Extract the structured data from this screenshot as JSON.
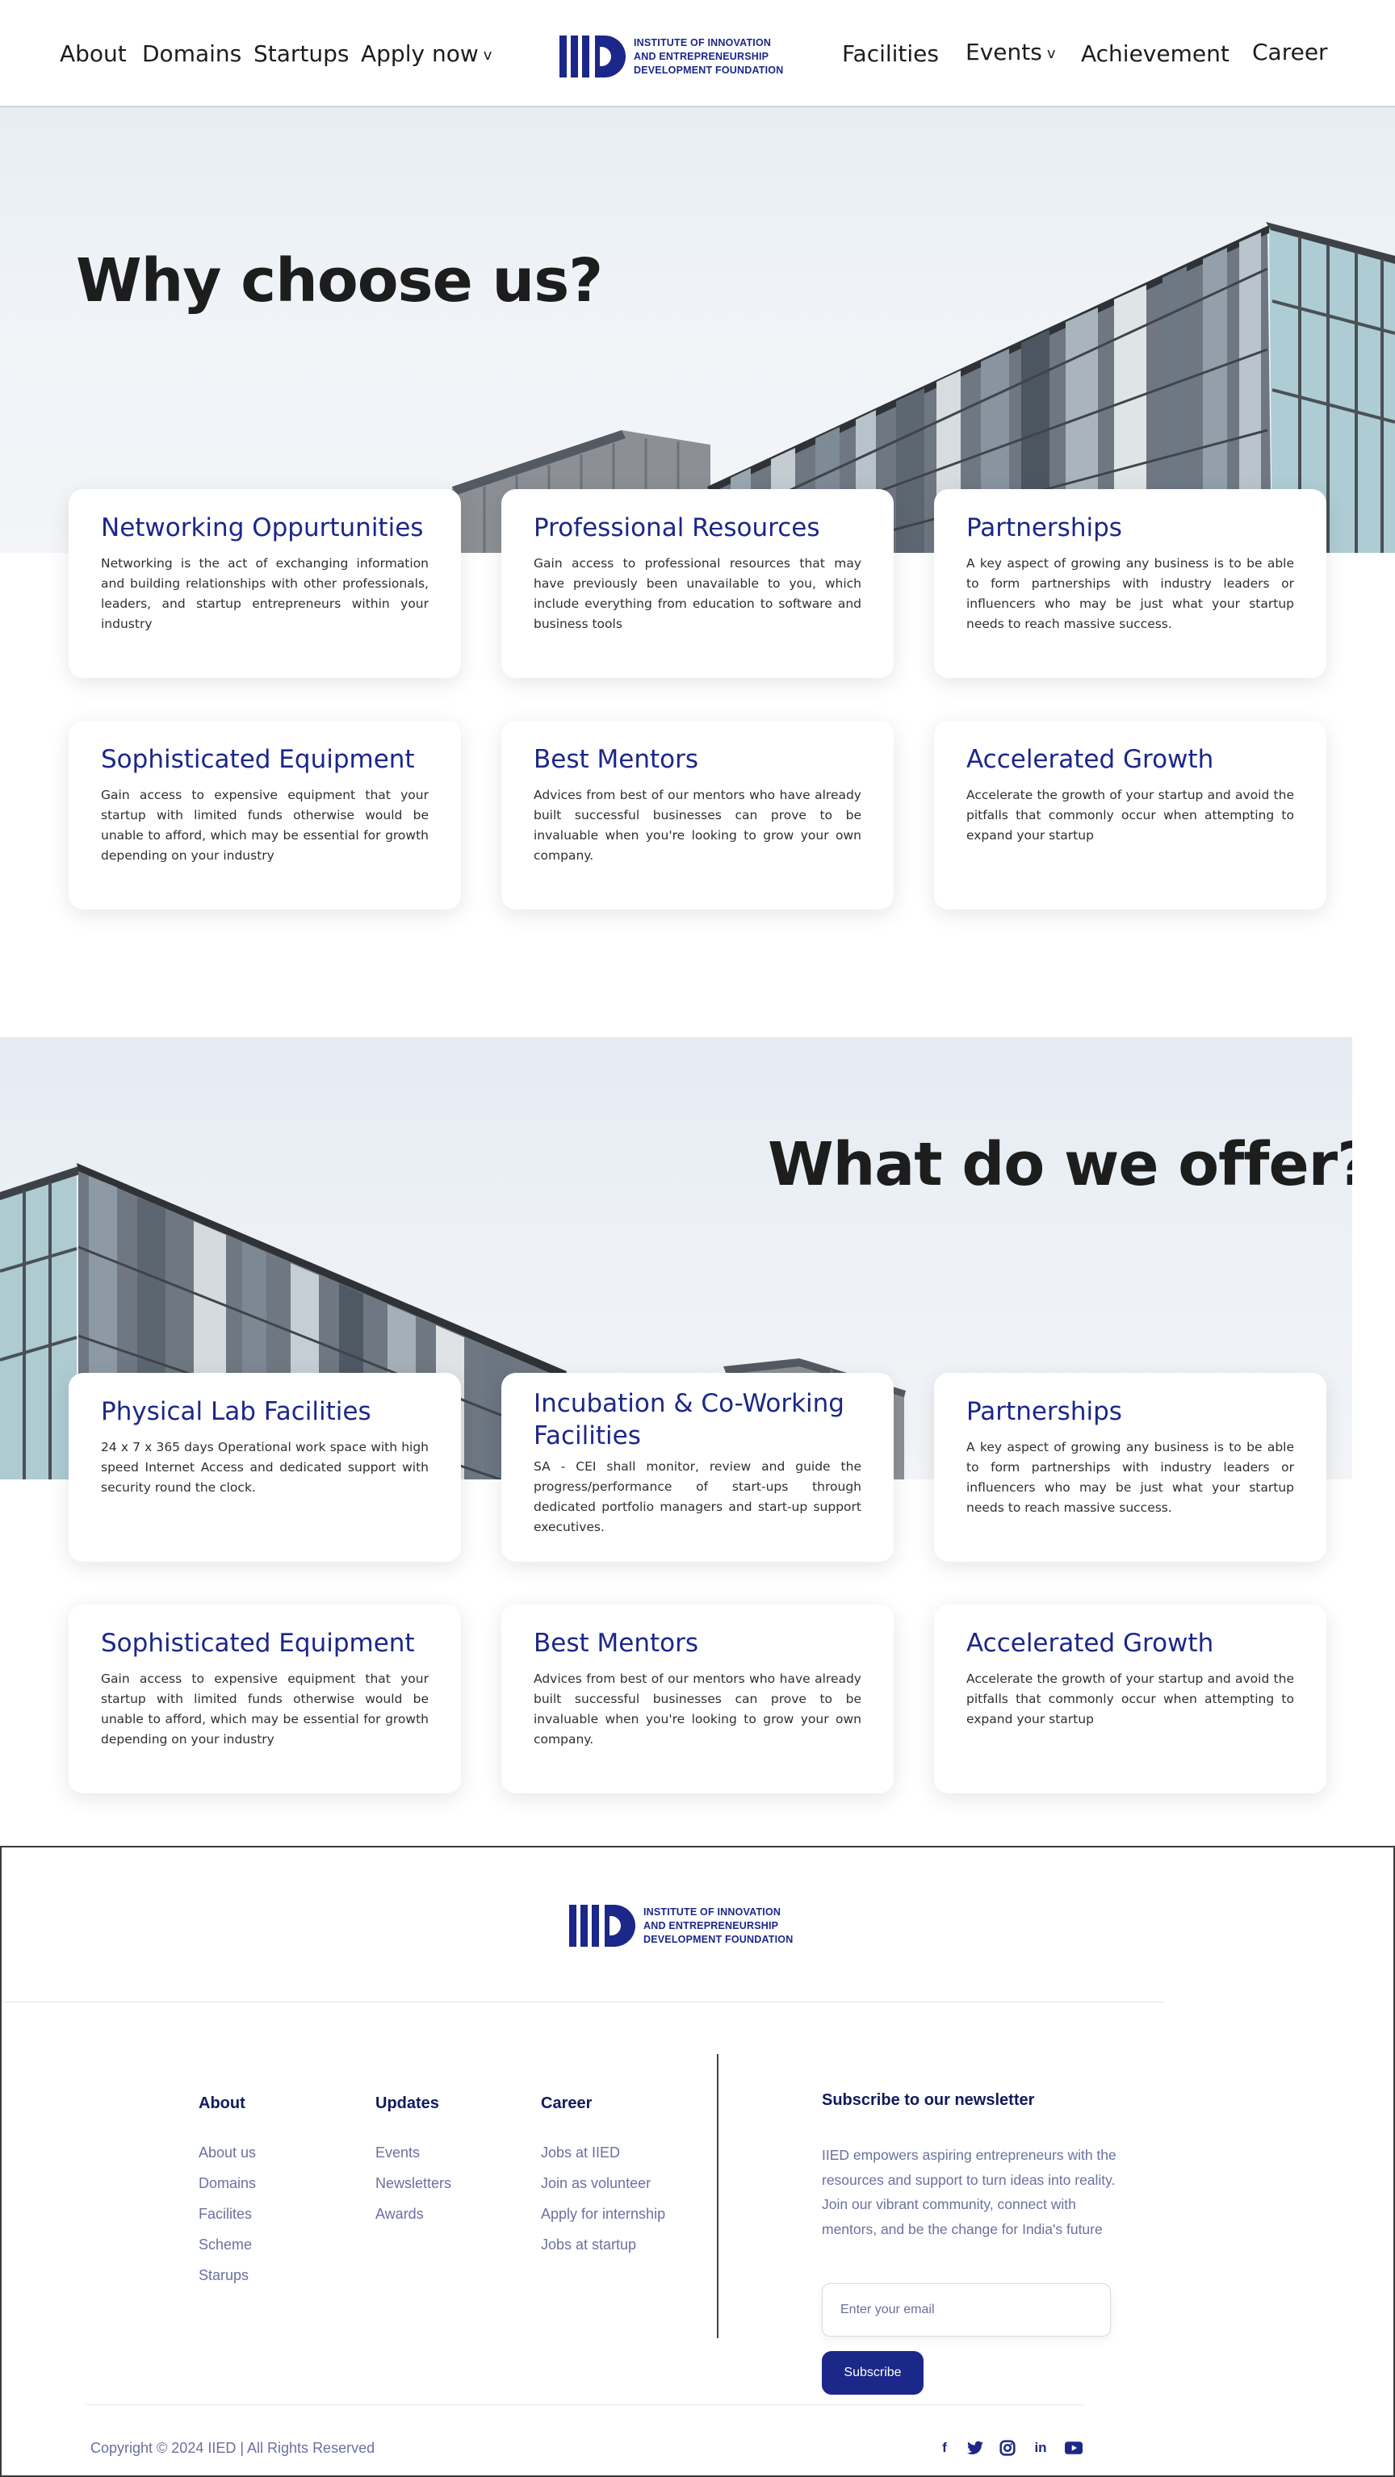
{
  "header": {
    "nav_left": [
      "About",
      "Domains",
      "Startups",
      "Apply now"
    ],
    "nav_right": [
      "Facilities",
      "Events",
      "Achievement",
      "Career"
    ],
    "caret": "v",
    "logo_lines": [
      "INSTITUTE OF INNOVATION",
      "AND ENTREPRENEURSHIP",
      "DEVELOPMENT FOUNDATION"
    ]
  },
  "section1": {
    "title": "Why choose us?",
    "cards": [
      {
        "title": "Networking Oppurtunities",
        "text": "Networking is the act of exchanging information and building relationships with other professionals, leaders, and startup entrepreneurs within your industry"
      },
      {
        "title": "Professional Resources",
        "text": "Gain access to professional resources that may have previously been unavailable to you, which include everything from education to software and business tools"
      },
      {
        "title": "Partnerships",
        "text": "A key aspect of growing any business is to be able to form partnerships with industry leaders or influencers who may be just what your startup needs to reach massive success."
      },
      {
        "title": "Sophisticated Equipment",
        "text": "Gain access to expensive equipment that your startup with limited funds otherwise would be unable to afford, which may be essential for growth depending on your industry"
      },
      {
        "title": "Best Mentors",
        "text": "Advices from best of our mentors who have already built successful businesses can prove to be invaluable when you're looking to grow your own company."
      },
      {
        "title": "Accelerated Growth",
        "text": "Accelerate the growth of your startup and avoid the pitfalls that commonly occur when attempting to expand your startup"
      }
    ]
  },
  "section2": {
    "title": "What do we offer?",
    "cards": [
      {
        "title": "Physical Lab Facilities",
        "text": "24 x 7 x 365 days Operational work space with high speed Internet Access and dedicated support with security round the clock."
      },
      {
        "title": "Incubation & Co-Working Facilities",
        "text": "SA - CEI shall monitor, review and guide the progress/performance of start-ups through dedicated portfolio managers and start-up support executives."
      },
      {
        "title": "Partnerships",
        "text": "A key aspect of growing any business is to be able to form partnerships with industry leaders or influencers who may be just what your startup needs to reach massive success."
      },
      {
        "title": "Sophisticated Equipment",
        "text": "Gain access to expensive equipment that your startup with limited funds otherwise would be unable to afford, which may be essential for growth depending on your industry"
      },
      {
        "title": "Best Mentors",
        "text": "Advices from best of our mentors who have already built successful businesses can prove to be invaluable when you're looking to grow your own company."
      },
      {
        "title": "Accelerated Growth",
        "text": "Accelerate the growth of your startup and avoid the pitfalls that commonly occur when attempting to expand your startup"
      }
    ]
  },
  "footer": {
    "logo_lines": [
      "INSTITUTE OF INNOVATION",
      "AND ENTREPRENEURSHIP",
      "DEVELOPMENT FOUNDATION"
    ],
    "columns": [
      {
        "heading": "About",
        "links": [
          "About us",
          "Domains",
          "Facilites",
          "Scheme",
          "Starups"
        ]
      },
      {
        "heading": "Updates",
        "links": [
          "Events",
          "Newsletters",
          "Awards"
        ]
      },
      {
        "heading": "Career",
        "links": [
          "Jobs at IIED",
          "Join as volunteer",
          "Apply for internship",
          "Jobs at startup"
        ]
      }
    ],
    "newsletter": {
      "heading": "Subscribe to our newsletter",
      "text": "IIED empowers aspiring entrepreneurs with the resources and support to turn ideas into reality. Join our vibrant community, connect with mentors, and be the change for India's future",
      "placeholder": "Enter your email",
      "button": "Subscribe"
    },
    "copyright": "Copyright © 2024 IIED  | All Rights Reserved",
    "social": [
      {
        "icon": "facebook-icon",
        "glyph": "f"
      },
      {
        "icon": "twitter-icon",
        "glyph": ""
      },
      {
        "icon": "instagram-icon",
        "glyph": ""
      },
      {
        "icon": "linkedin-icon",
        "glyph": "in"
      },
      {
        "icon": "youtube-icon",
        "glyph": ""
      }
    ]
  },
  "colors": {
    "brand": "#1b2789",
    "text_dark": "#1d1d1d",
    "muted": "#6b70a0"
  }
}
